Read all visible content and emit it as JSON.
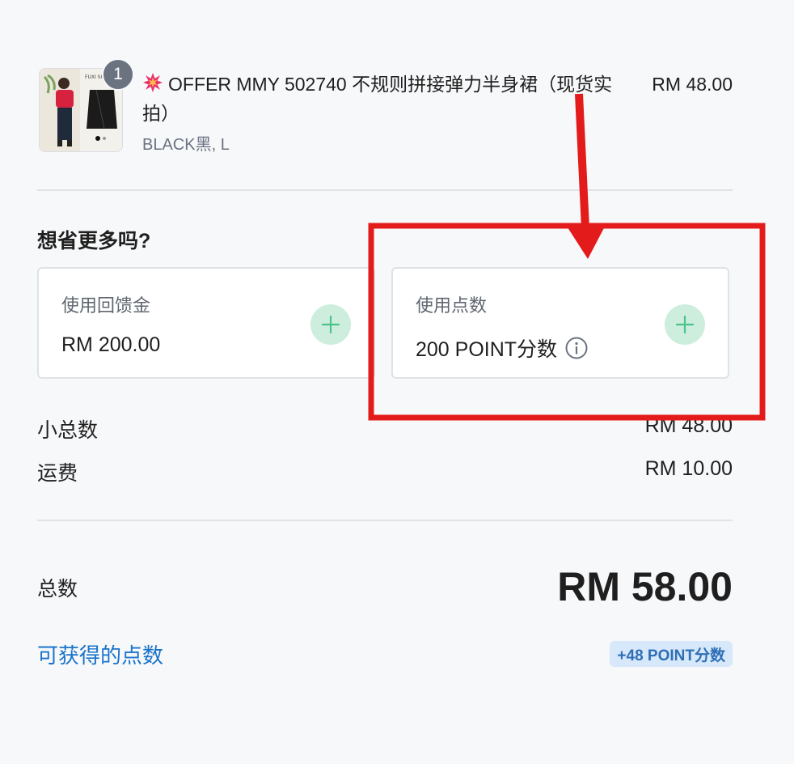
{
  "product": {
    "quantity": "1",
    "title": "OFFER MMY 502740 不规则拼接弹力半身裙（现货实拍）",
    "variant": "BLACK黑, L",
    "price": "RM 48.00",
    "thumbnail_text": "FUXI SUB"
  },
  "savings": {
    "heading": "想省更多吗?",
    "cashback": {
      "label": "使用回馈金",
      "value": "RM 200.00"
    },
    "points": {
      "label": "使用点数",
      "value": "200 POINT分数"
    }
  },
  "summary": {
    "subtotal_label": "小总数",
    "subtotal_value": "RM 48.00",
    "shipping_label": "运费",
    "shipping_value": "RM 10.00",
    "total_label": "总数",
    "total_value": "RM 58.00",
    "earn_label": "可获得的点数",
    "earn_value": "+48 POINT分数"
  },
  "colors": {
    "accent_blue": "#1a73c9",
    "plus_green": "#4cc38a",
    "annotation_red": "#e41b1b"
  },
  "icons": {
    "product_icon": "burst-icon",
    "add_icon": "plus-icon",
    "info_icon": "info-icon"
  }
}
